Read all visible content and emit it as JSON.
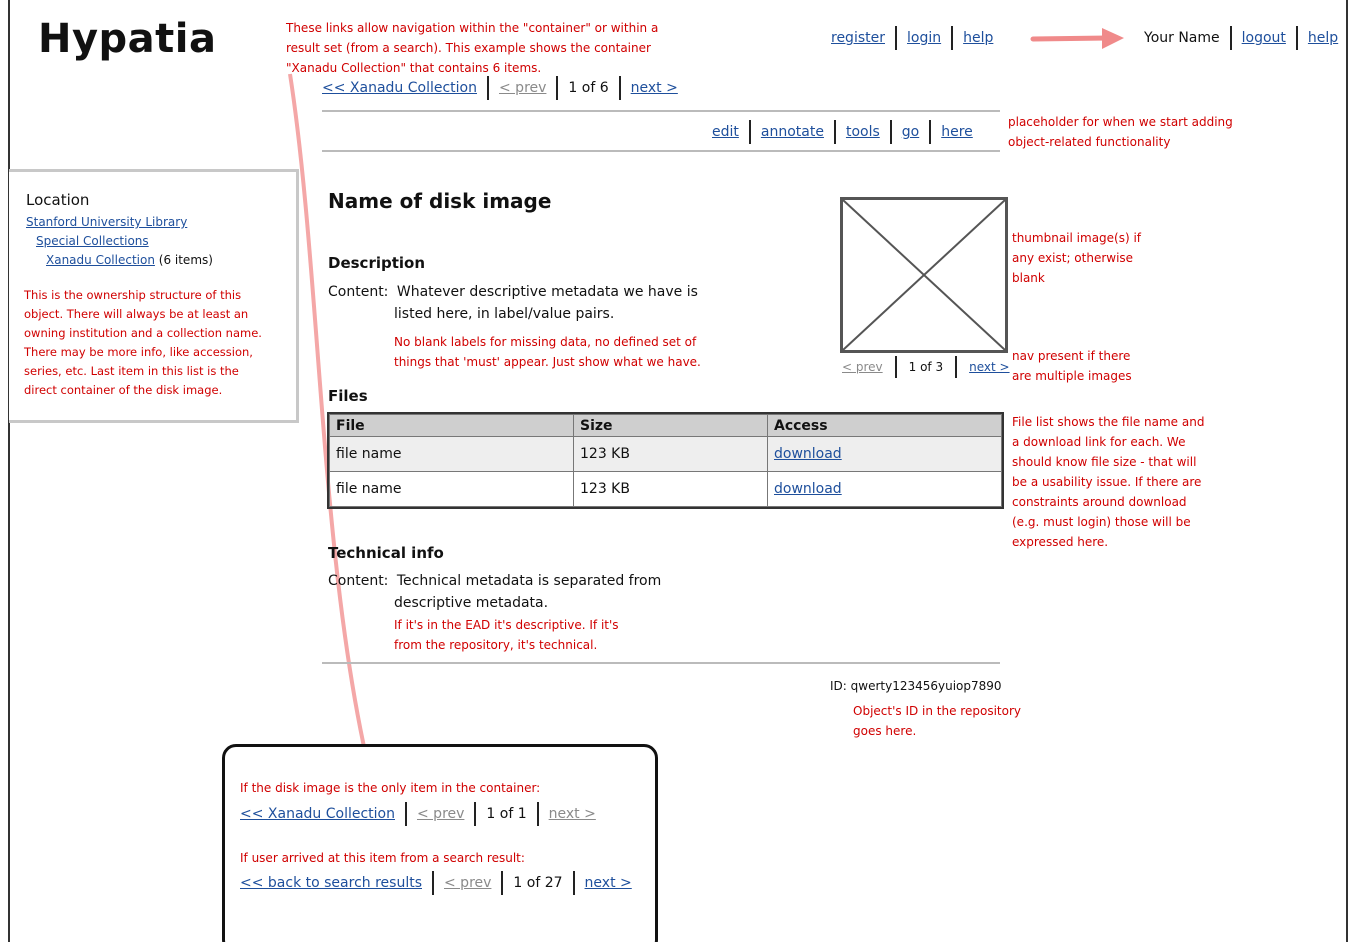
{
  "app": {
    "logo": "Hypatia"
  },
  "header": {
    "links": [
      "register",
      "login",
      "help"
    ],
    "user": {
      "name": "Your Name",
      "logout": "logout",
      "help": "help"
    }
  },
  "container_nav": {
    "back": "<< Xanadu Collection",
    "prev": "< prev",
    "position": "1 of 6",
    "next": "next >"
  },
  "actions": [
    "edit",
    "annotate",
    "tools",
    "go",
    "here"
  ],
  "sidebar": {
    "title": "Location",
    "items": [
      {
        "label": "Stanford University Library"
      },
      {
        "label": "Special Collections"
      },
      {
        "label": "Xanadu Collection",
        "suffix": "(6 items)"
      }
    ]
  },
  "main": {
    "title": "Name of disk image",
    "description": {
      "heading": "Description",
      "label": "Content:",
      "line1": "Whatever descriptive metadata we have is",
      "line2": "listed here, in label/value pairs."
    },
    "files": {
      "heading": "Files",
      "columns": [
        "File",
        "Size",
        "Access"
      ],
      "rows": [
        {
          "file": "file name",
          "size": "123 KB",
          "access": "download"
        },
        {
          "file": "file name",
          "size": "123 KB",
          "access": "download"
        }
      ]
    },
    "technical": {
      "heading": "Technical info",
      "label": "Content:",
      "line1": "Technical metadata is separated from",
      "line2": "descriptive metadata."
    },
    "id": "ID: qwerty123456yuiop7890"
  },
  "thumbnail_nav": {
    "prev": "< prev",
    "position": "1 of 3",
    "next": "next >"
  },
  "notes": {
    "nav_note": [
      "These links allow navigation within the \"container\" or within a",
      "result set (from a search). This example shows the container",
      "\"Xanadu Collection\" that contains 6 items."
    ],
    "actions_note": [
      "placeholder for when we start adding",
      "object-related functionality"
    ],
    "ownership_note": [
      "This is the ownership structure of this",
      "object. There will always be at least an",
      "owning institution and a collection name.",
      "There may be more info, like accession,",
      "series, etc. Last item in this list is the",
      "direct container of the disk image."
    ],
    "description_note": [
      "No blank labels for missing data, no defined set of",
      "things that 'must' appear. Just show what we have."
    ],
    "thumb_note": [
      "thumbnail image(s) if",
      "any exist; otherwise",
      "blank"
    ],
    "thumbnav_note": [
      "nav present if there",
      "are multiple images"
    ],
    "files_note": [
      "File list shows the file name and",
      "a download link for each. We",
      "should know file size - that will",
      "be a usability issue. If there are",
      "constraints around download",
      "(e.g. must login) those will be",
      "expressed here."
    ],
    "tech_note": [
      "If it's in the EAD it's descriptive. If it's",
      "from the repository, it's technical."
    ],
    "id_note": [
      "Object's ID in the repository",
      "goes here."
    ]
  },
  "callout": {
    "case1": "If the disk image is the only item in the container:",
    "nav1": {
      "back": "<< Xanadu Collection",
      "prev": "< prev",
      "position": "1 of 1",
      "next": "next >"
    },
    "case2": "If user arrived at this item from a search result:",
    "nav2": {
      "back": "<< back to search results",
      "prev": "< prev",
      "position": "1 of 27",
      "next": "next >"
    }
  },
  "colors": {
    "note": "#d00000",
    "link": "#1e4f9c",
    "arrow": "#f08a8a"
  }
}
